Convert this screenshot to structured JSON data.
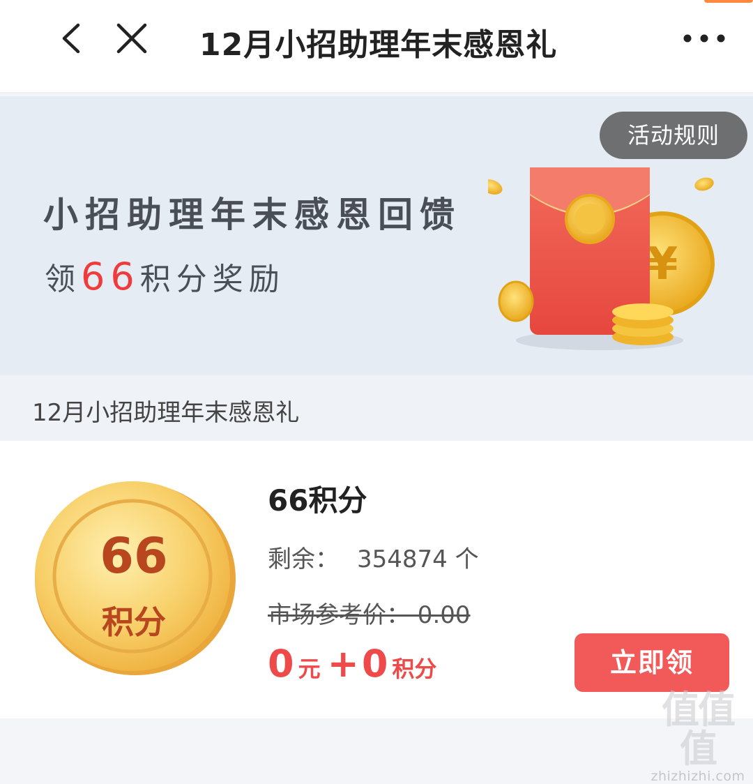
{
  "nav": {
    "title": "12月小招助理年末感恩礼"
  },
  "banner": {
    "rules_label": "活动规则",
    "headline": "小招助理年末感恩回馈",
    "sub_prefix": "领",
    "sub_number": "66",
    "sub_suffix": "积分奖励"
  },
  "section": {
    "label": "12月小招助理年末感恩礼"
  },
  "product": {
    "coin_number": "66",
    "coin_unit": "积分",
    "name": "66积分",
    "remaining_label": "剩余：",
    "remaining_value": "354874 个",
    "market_price": "市场参考价： 0.00",
    "price_cash": "0",
    "price_cash_unit": "元",
    "price_plus": "+",
    "price_points": "0",
    "price_points_unit": "积分",
    "claim_label": "立即领"
  },
  "watermark": {
    "logo": "值值值",
    "url": "zhizhizhi.com"
  },
  "colors": {
    "accent_red": "#f25a5a",
    "price_red": "#ef4a4a",
    "coin_gold": "#f3c35c"
  }
}
